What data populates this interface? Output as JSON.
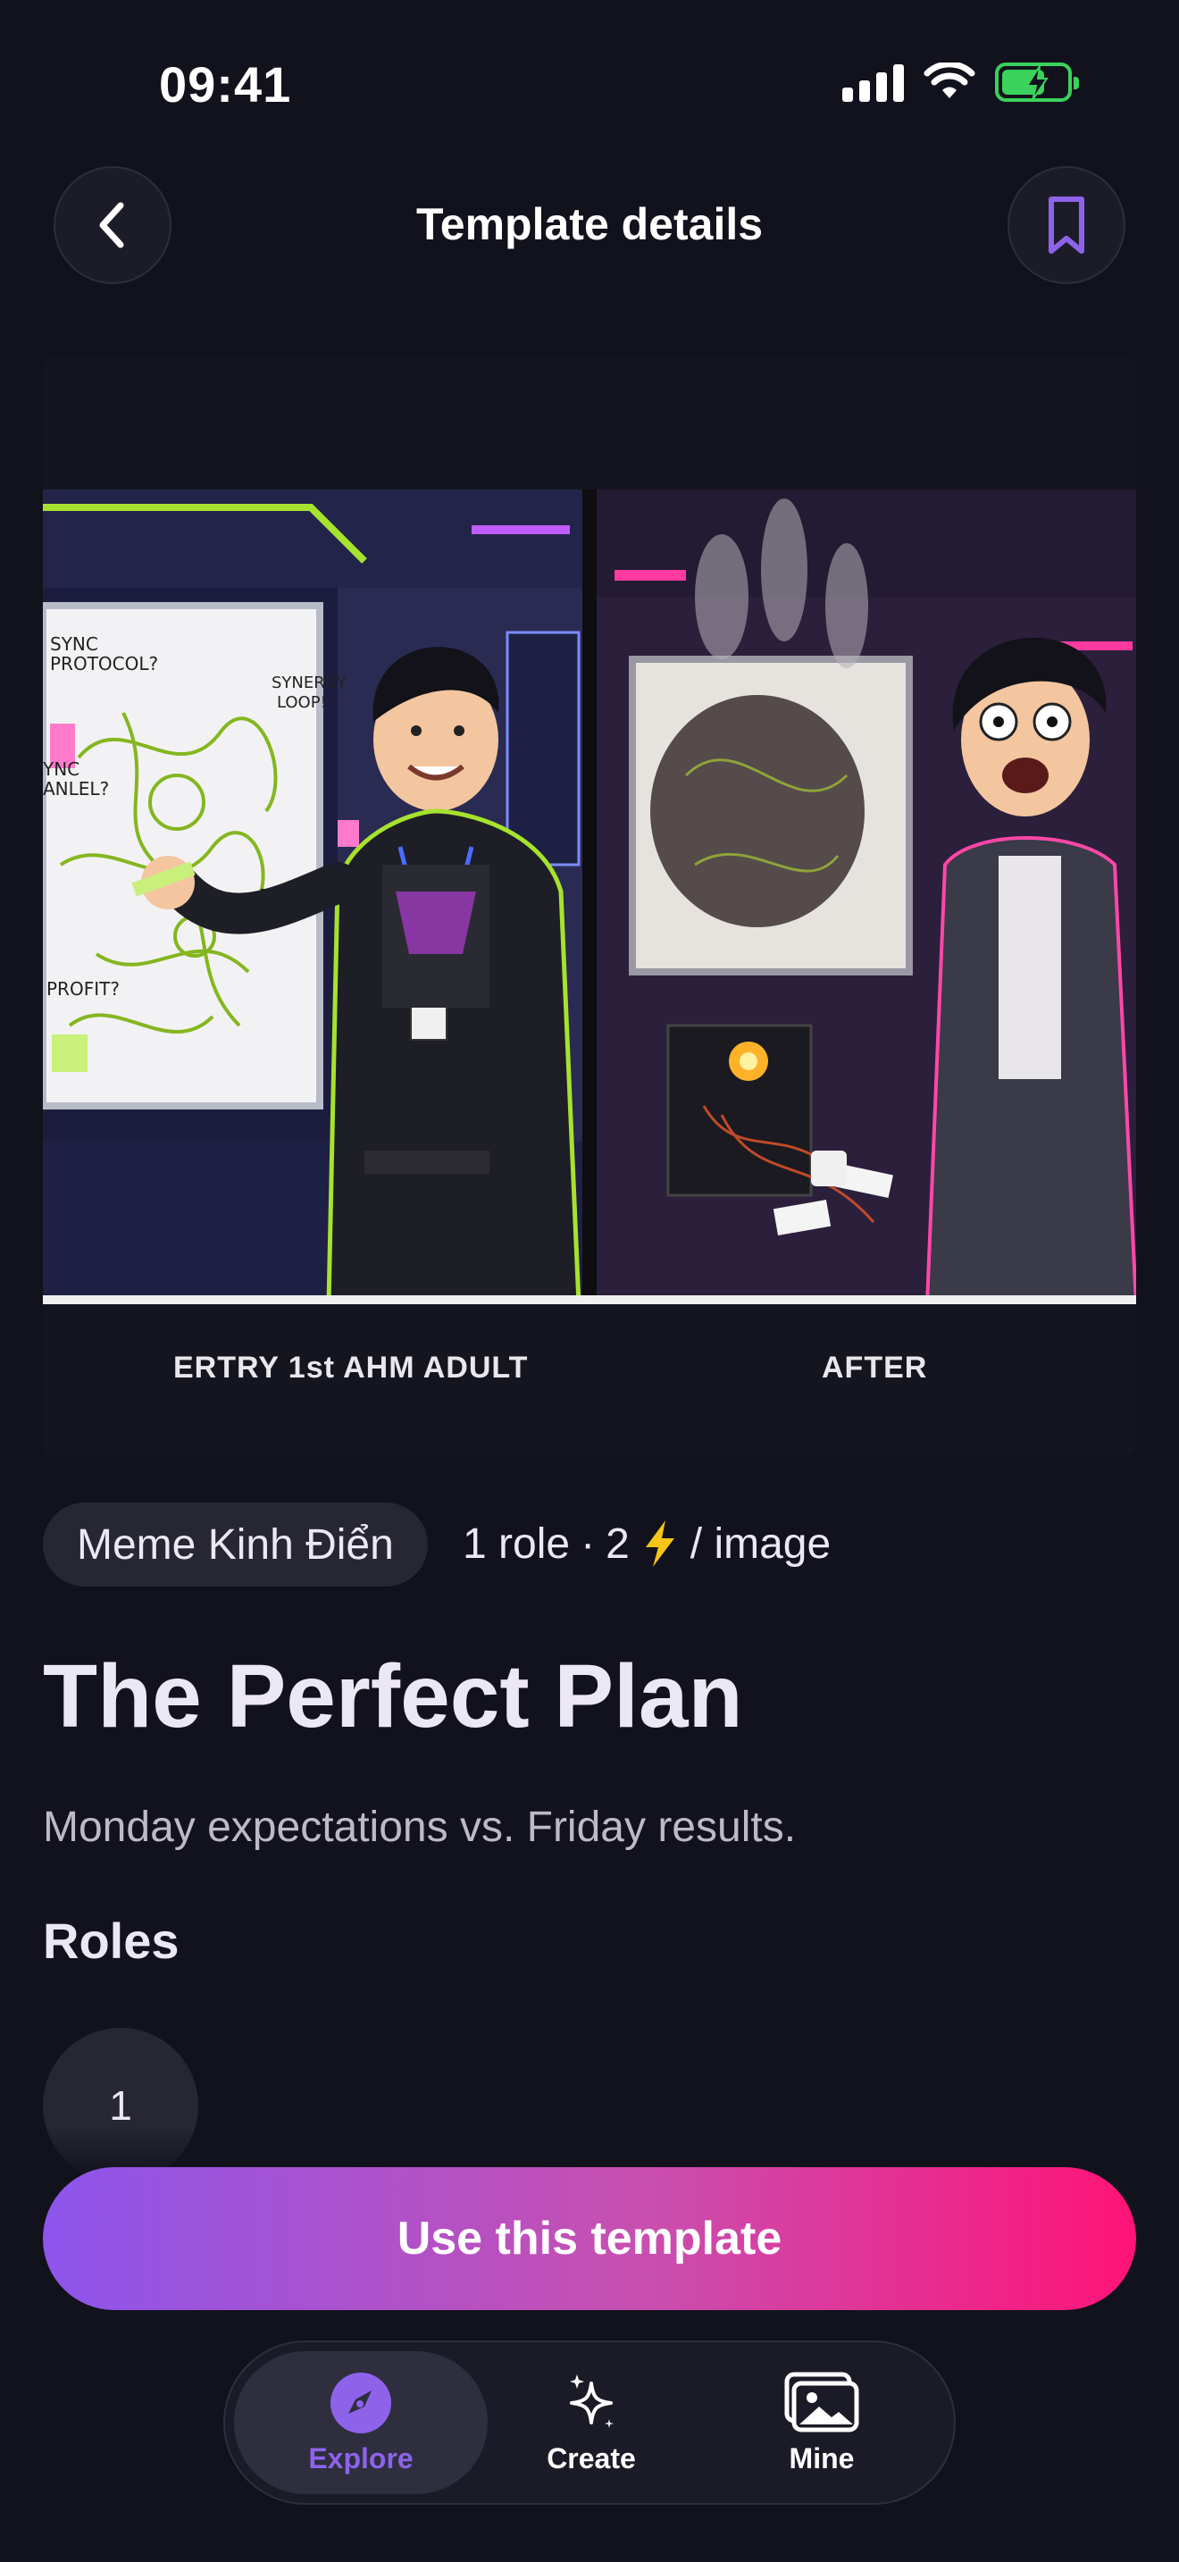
{
  "status_bar": {
    "time": "09:41"
  },
  "header": {
    "title": "Template details"
  },
  "hero": {
    "caption_left": "ERTRY 1st AHM ADULT",
    "caption_right": "AFTER",
    "whiteboard_left": [
      "SYNC PROTOCOL?",
      "SYNERGY LOOP!",
      "SYNC ANLEL?",
      "PROFIT?",
      "PROFIT?"
    ]
  },
  "template": {
    "category": "Meme Kinh Điển",
    "meta": {
      "roles_count": "1 role",
      "separator": "·",
      "cost": "2",
      "per_image": "/ image"
    },
    "title": "The Perfect Plan",
    "description": "Monday expectations vs. Friday results.",
    "roles_heading": "Roles",
    "roles": [
      "1"
    ]
  },
  "cta": {
    "label": "Use this template"
  },
  "tabbar": {
    "items": [
      {
        "label": "Explore",
        "icon": "compass-icon",
        "active": true
      },
      {
        "label": "Create",
        "icon": "sparkles-icon",
        "active": false
      },
      {
        "label": "Mine",
        "icon": "images-icon",
        "active": false
      }
    ]
  },
  "colors": {
    "background": "#12121d",
    "accent_purple": "#8e63ea",
    "gradient_start": "#8d55ec",
    "gradient_end": "#ff1378",
    "lightning": "#f5c518",
    "battery_green": "#3ad25c"
  }
}
